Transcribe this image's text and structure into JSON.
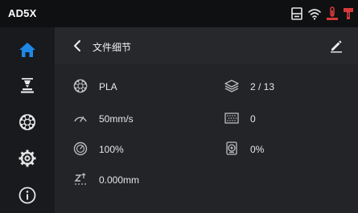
{
  "status": {
    "brand": "AD5X",
    "icons": [
      "printer-icon",
      "wifi-icon",
      "extruder-temp-icon",
      "bed-temp-icon"
    ],
    "colors": {
      "normal": "#e6e6e6",
      "alert": "#d83a3a"
    }
  },
  "sidebar": {
    "items": [
      {
        "name": "home",
        "icon": "home-icon",
        "active": true
      },
      {
        "name": "print",
        "icon": "print-nozzle-icon"
      },
      {
        "name": "filament",
        "icon": "filament-spool-icon"
      },
      {
        "name": "settings",
        "icon": "gear-icon"
      },
      {
        "name": "about",
        "icon": "info-icon"
      }
    ],
    "active_color": "#1e88e5"
  },
  "header": {
    "title": "文件细节",
    "back_icon": "chevron-left-icon",
    "edit_icon": "pencil-icon"
  },
  "details": {
    "material": "PLA",
    "speed": "50mm/s",
    "flow": "100%",
    "z_offset": "0.000mm",
    "layers": "2 / 13",
    "infill": "0",
    "fan": "0%"
  }
}
